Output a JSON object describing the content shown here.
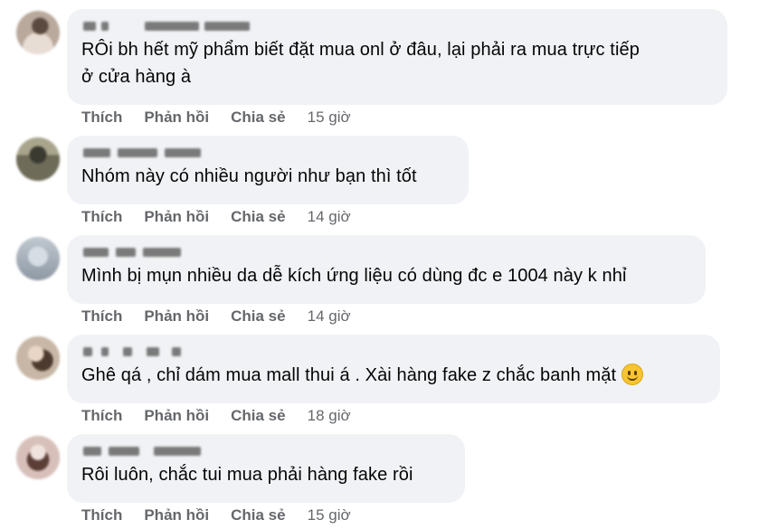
{
  "actions": {
    "like": "Thích",
    "reply": "Phản hồi",
    "share": "Chia sẻ"
  },
  "comments": [
    {
      "text": "RÔi bh hết mỹ phẩm biết đặt mua onl ở đâu, lại phải ra mua trực tiếp\nở cửa hàng à",
      "time": "15 giờ",
      "avatar_color": "#b9a99c"
    },
    {
      "text": "Nhóm này có nhiều người như bạn thì tốt",
      "time": "14 giờ",
      "avatar_color": "#8f8a74"
    },
    {
      "text": "Mình bị mụn nhiều da dễ kích ứng liệu có dùng đc e 1004 này k nhỉ",
      "time": "14 giờ",
      "avatar_color": "#aab4c0"
    },
    {
      "text": "Ghê qá , chỉ dám mua mall thui á . Xài hàng fake z chắc banh mặt",
      "time": "18 giờ",
      "avatar_color": "#b7a493",
      "emoji": "smiling-face-emoji"
    },
    {
      "text": "Rôi luôn, chắc tui mua phải hàng fake rồi",
      "time": "15 giờ",
      "avatar_color": "#c3a9a4"
    }
  ]
}
